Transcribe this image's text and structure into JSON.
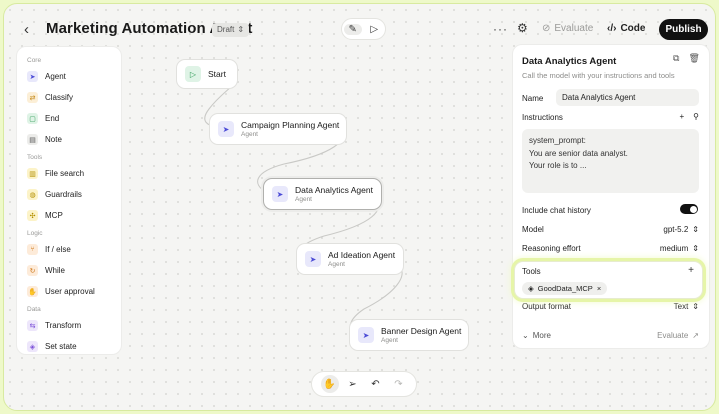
{
  "header": {
    "back_icon": "chevron-left-icon",
    "title": "Marketing Automation Agent",
    "badge": "Draft",
    "evaluate_label": "Evaluate",
    "code_label": "Code",
    "publish_label": "Publish"
  },
  "palette": {
    "sections": [
      {
        "title": "Core",
        "items": [
          {
            "label": "Agent",
            "icon": "cursor-icon",
            "color": "#e8e8fb",
            "fg": "#4b4bd6"
          },
          {
            "label": "Classify",
            "icon": "split-icon",
            "color": "#fcefd7",
            "fg": "#c58a1a"
          },
          {
            "label": "End",
            "icon": "stop-icon",
            "color": "#dff3e6",
            "fg": "#2d9a55"
          },
          {
            "label": "Note",
            "icon": "note-icon",
            "color": "#ececea",
            "fg": "#555"
          }
        ]
      },
      {
        "title": "Tools",
        "items": [
          {
            "label": "File search",
            "icon": "file-icon",
            "color": "#fcf3c8",
            "fg": "#b38f00"
          },
          {
            "label": "Guardrails",
            "icon": "shield-icon",
            "color": "#fcf3c8",
            "fg": "#b38f00"
          },
          {
            "label": "MCP",
            "icon": "plug-icon",
            "color": "#fcf3c8",
            "fg": "#b38f00"
          }
        ]
      },
      {
        "title": "Logic",
        "items": [
          {
            "label": "If / else",
            "icon": "branch-icon",
            "color": "#fdebd9",
            "fg": "#d07a1c"
          },
          {
            "label": "While",
            "icon": "loop-icon",
            "color": "#fdebd9",
            "fg": "#d07a1c"
          },
          {
            "label": "User approval",
            "icon": "hand-icon",
            "color": "#fdebd9",
            "fg": "#d07a1c"
          }
        ]
      },
      {
        "title": "Data",
        "items": [
          {
            "label": "Transform",
            "icon": "transform-icon",
            "color": "#ede6fb",
            "fg": "#7a4fd8"
          },
          {
            "label": "Set state",
            "icon": "state-icon",
            "color": "#ede6fb",
            "fg": "#7a4fd8"
          }
        ]
      }
    ]
  },
  "nodes": {
    "start": {
      "label": "Start"
    },
    "campaign": {
      "label": "Campaign Planning Agent",
      "sub": "Agent"
    },
    "analytics": {
      "label": "Data Analytics Agent",
      "sub": "Agent"
    },
    "ideation": {
      "label": "Ad Ideation Agent",
      "sub": "Agent"
    },
    "banner": {
      "label": "Banner Design Agent",
      "sub": "Agent"
    }
  },
  "panel": {
    "title": "Data Analytics Agent",
    "description": "Call the model with your instructions and tools",
    "name_label": "Name",
    "name_value": "Data Analytics Agent",
    "instructions_label": "Instructions",
    "instructions_lines": [
      "system_prompt:",
      "You are senior data analyst.",
      "Your role is to ..."
    ],
    "chat_history_label": "Include chat history",
    "model_label": "Model",
    "model_value": "gpt-5.2",
    "reasoning_label": "Reasoning effort",
    "reasoning_value": "medium",
    "tools_label": "Tools",
    "tool_chip": "GoodData_MCP",
    "output_label": "Output format",
    "output_value": "Text",
    "more_label": "More",
    "evaluate_label": "Evaluate"
  }
}
